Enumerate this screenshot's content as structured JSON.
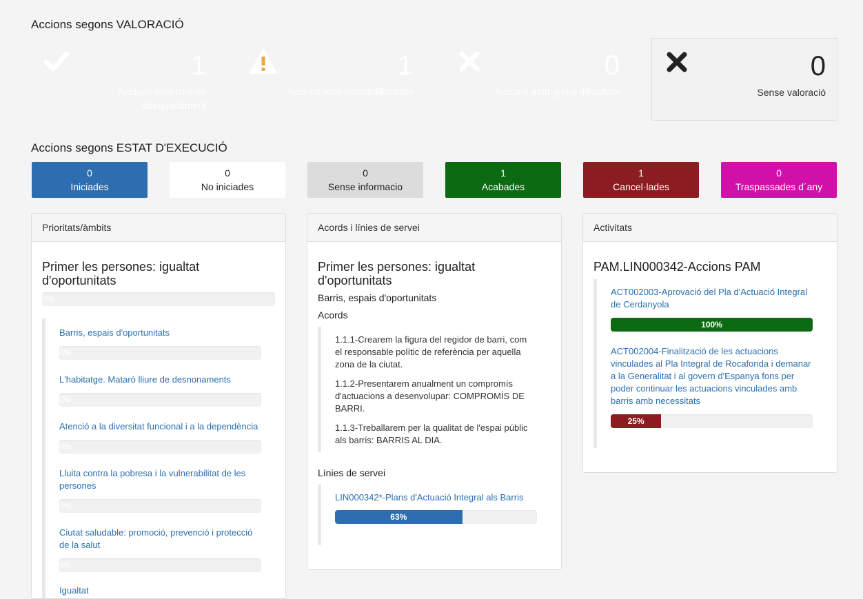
{
  "valoracio": {
    "title": "Accions segons VALORACIÓ",
    "cards": [
      {
        "icon": "check-icon",
        "value": "1",
        "label": "Accions evolucionen adequadament",
        "color": "#4cad50"
      },
      {
        "icon": "warning-icon",
        "value": "1",
        "label": "Accions amb retard/dificultats",
        "color": "#efa544"
      },
      {
        "icon": "close-icon",
        "value": "0",
        "label": "Accions amb greus dificultats",
        "color": "#d64a47"
      },
      {
        "icon": "cross-icon",
        "value": "0",
        "label": "Sense valoració",
        "color": "#f2f2f2"
      }
    ]
  },
  "estat": {
    "title": "Accions segons ESTAT D'EXECUCIÓ",
    "items": [
      {
        "value": "0",
        "label": "Iniciades",
        "color": "#2c6eaf",
        "text_color": "#ffffff"
      },
      {
        "value": "0",
        "label": "No iniciades",
        "color": "#ffffff",
        "text_color": "#222222"
      },
      {
        "value": "0",
        "label": "Sense informacio",
        "color": "#dcdcdc",
        "text_color": "#222222"
      },
      {
        "value": "1",
        "label": "Acabades",
        "color": "#0b6b12",
        "text_color": "#ffffff"
      },
      {
        "value": "1",
        "label": "Cancel·lades",
        "color": "#8b1c1f",
        "text_color": "#ffffff"
      },
      {
        "value": "0",
        "label": "Traspassades d´any",
        "color": "#d010a8",
        "text_color": "#ffffff"
      }
    ]
  },
  "prioritats": {
    "header": "Prioritats/àmbits",
    "title": "Primer les persones: igualtat d'oportunitats",
    "progress": {
      "value": 0,
      "label": "0%"
    },
    "items": [
      {
        "label": "Barris, espais d'oportunitats",
        "progress": 0,
        "progress_label": "0%"
      },
      {
        "label": "L'habitatge. Mataró lliure de desnonaments",
        "progress": 0,
        "progress_label": "0%"
      },
      {
        "label": "Atenció a la diversitat funcional i a la dependència",
        "progress": 0,
        "progress_label": "0%"
      },
      {
        "label": "Lluita contra la pobresa i la vulnerabilitat de les persones",
        "progress": 0,
        "progress_label": "0%"
      },
      {
        "label": "Ciutat saludable: promoció, prevenció i protecció de la salut",
        "progress": 0,
        "progress_label": "0%"
      },
      {
        "label": "Igualtat"
      }
    ]
  },
  "acords": {
    "header": "Acords i línies de servei",
    "title": "Primer les persones: igualtat d'oportunitats",
    "subtitle": "Barris, espais d'oportunitats",
    "acords_label": "Acords",
    "acords_items": [
      "1.1.1-Crearem la figura del regidor de barri, com el responsable polític de referència per aquella zona de la ciutat.",
      "1.1.2-Presentarem anualment un compromís d'actuacions a desenvolupar: COMPROMÍS DE BARRI.",
      "1.1.3-Treballarem per la qualitat de l'espai públic als barris: BARRIS AL DIA."
    ],
    "linies_label": "Línies de servei",
    "linies": [
      {
        "label": "LIN000342*-Plans d'Actuació Integral als Barris",
        "progress": 63,
        "progress_label": "63%",
        "color": "#2c6eaf"
      }
    ]
  },
  "activitats": {
    "header": "Activitats",
    "title": "PAM.LIN000342-Accions PAM",
    "items": [
      {
        "label": "ACT002003-Aprovació del Pla d'Actuació Integral de Cerdanyola",
        "progress": 100,
        "progress_label": "100%",
        "color": "#0b6b12"
      },
      {
        "label": "ACT002004-Finalització de les actuacions vinculades al Pla Integral de Rocafonda i demanar a la Generalitat i al govern d'Espanya fons per poder continuar les actuacions vinculades amb barris amb necessitats",
        "progress": 25,
        "progress_label": "25%",
        "color": "#8b1c1f"
      }
    ]
  }
}
